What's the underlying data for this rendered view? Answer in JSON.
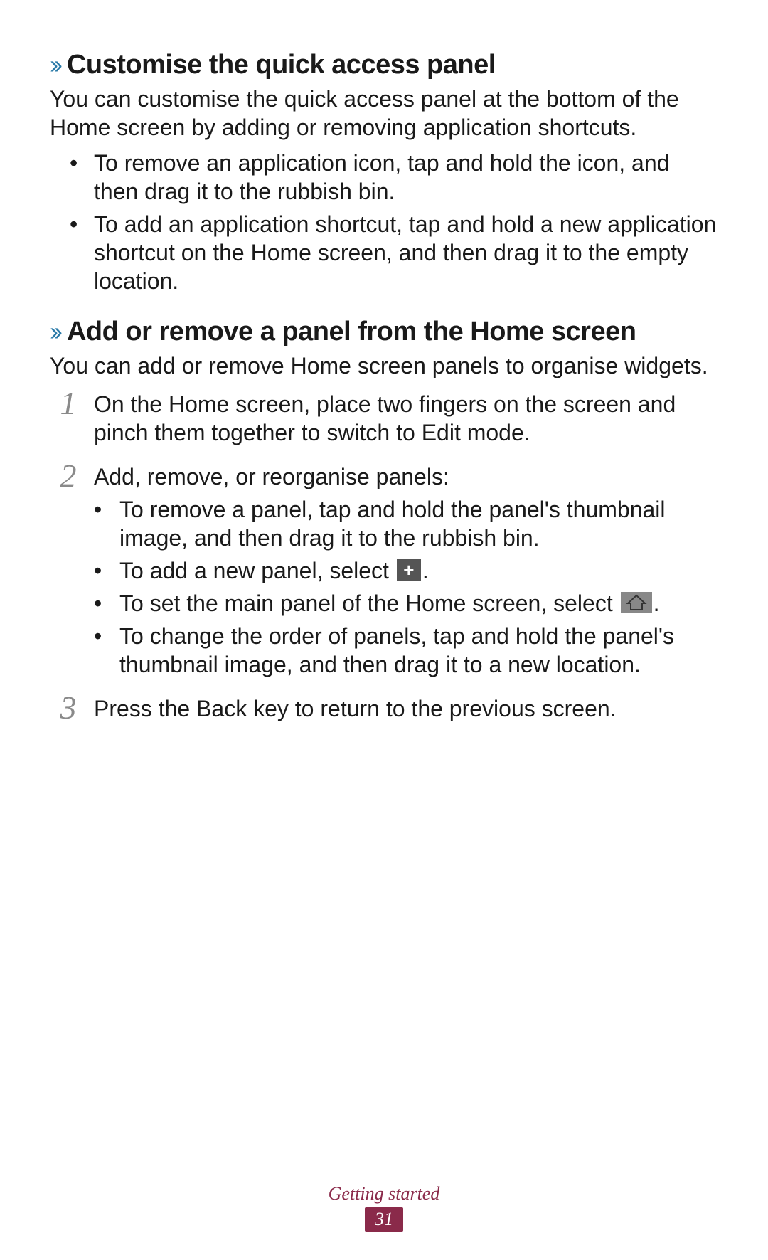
{
  "section1": {
    "title": "Customise the quick access panel",
    "intro": "You can customise the quick access panel at the bottom of the Home screen by adding or removing application shortcuts.",
    "bullets": [
      "To remove an application icon, tap and hold the icon, and then drag it to the rubbish bin.",
      "To add an application shortcut, tap and hold a new application shortcut on the Home screen, and then drag it to the empty location."
    ]
  },
  "section2": {
    "title": "Add or remove a panel from the Home screen",
    "intro": "You can add or remove Home screen panels to organise widgets.",
    "steps": {
      "s1": {
        "num": "1",
        "text": "On the Home screen, place two fingers on the screen and pinch them together to switch to Edit mode."
      },
      "s2": {
        "num": "2",
        "text": "Add, remove, or reorganise panels:",
        "sub": {
          "a": "To remove a panel, tap and hold the panel's thumbnail image, and then drag it to the rubbish bin.",
          "b_pre": "To add a new panel, select ",
          "b_post": ".",
          "c_pre": "To set the main panel of the Home screen, select ",
          "c_post": ".",
          "d": "To change the order of panels, tap and hold the panel's thumbnail image, and then drag it to a new location."
        }
      },
      "s3": {
        "num": "3",
        "text": "Press the Back key to return to the previous screen."
      }
    }
  },
  "footer": {
    "section_label": "Getting started",
    "page_number": "31"
  }
}
